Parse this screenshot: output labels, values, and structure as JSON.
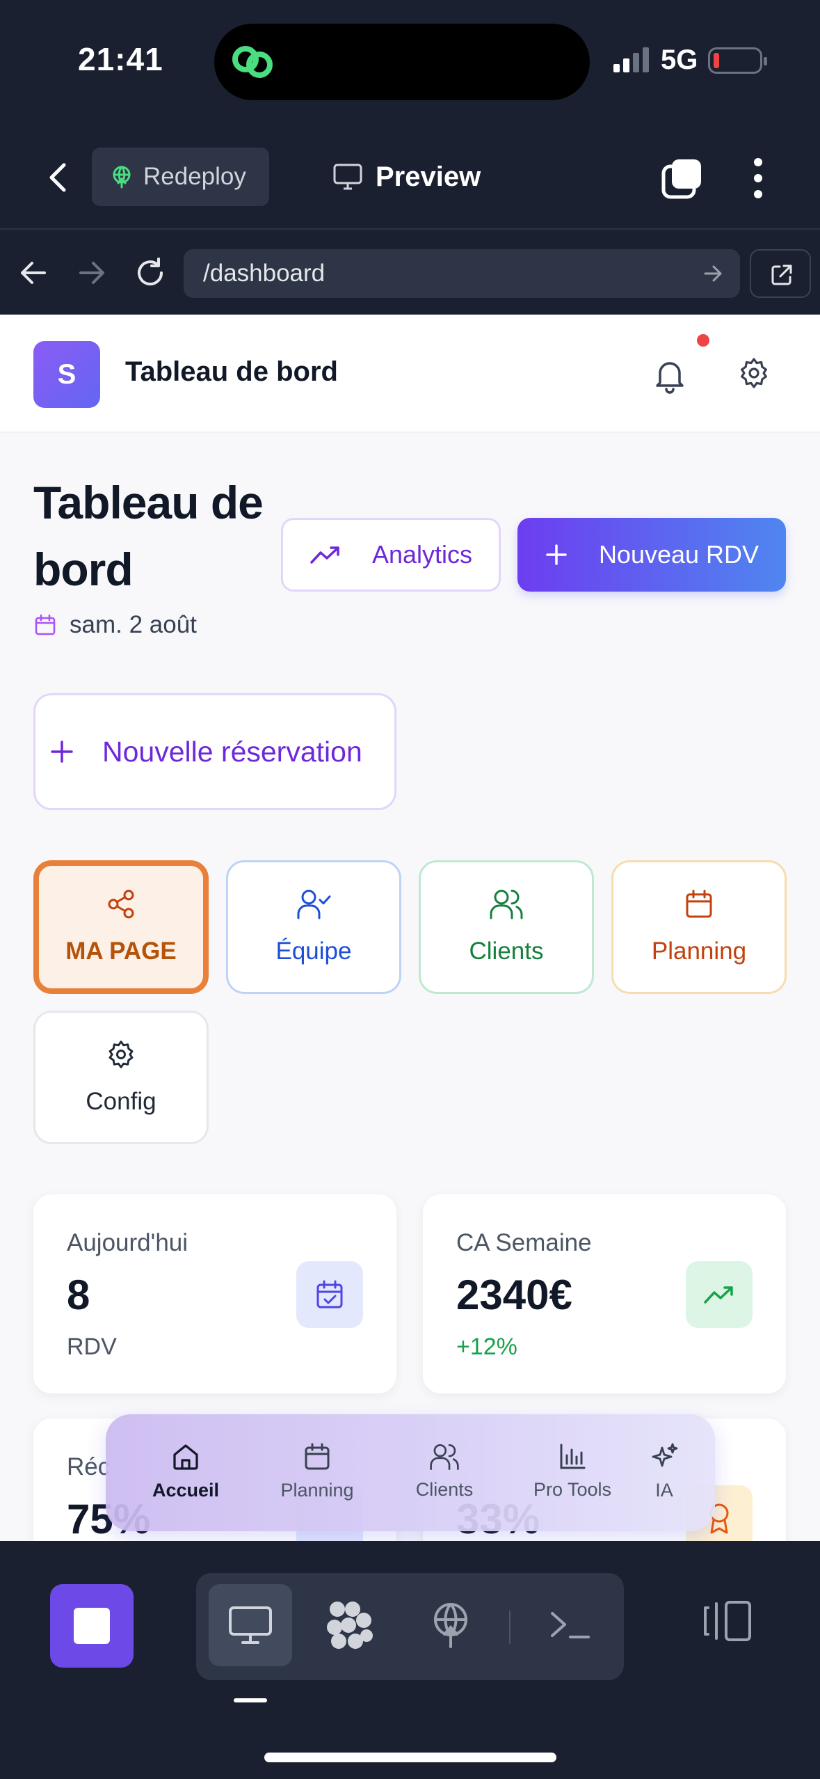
{
  "status": {
    "time": "21:41",
    "network": "5G"
  },
  "appbar": {
    "redeploy_label": "Redeploy",
    "preview_label": "Preview"
  },
  "browser": {
    "url": "/dashboard"
  },
  "page": {
    "header_title": "Tableau de bord",
    "logo_letter": "S",
    "title": "Tableau de bord",
    "date": "sam. 2 août",
    "analytics_label": "Analytics",
    "new_rdv_label": "Nouveau RDV",
    "new_reservation_label": "Nouvelle réservation",
    "tiles": {
      "ma_page": "MA PAGE",
      "equipe": "Équipe",
      "clients": "Clients",
      "planning": "Planning",
      "config": "Config"
    },
    "stats": {
      "today": {
        "label": "Aujourd'hui",
        "value": "8",
        "sub": "RDV"
      },
      "ca": {
        "label": "CA Semaine",
        "value": "2340€",
        "sub": "+12%"
      },
      "partial_left": {
        "label": "Réc",
        "value": "75%"
      },
      "partial_right": {
        "value": "33%"
      }
    }
  },
  "tabbar": {
    "items": [
      {
        "label": "Accueil",
        "icon": "home-icon",
        "active": true
      },
      {
        "label": "Planning",
        "icon": "calendar-icon",
        "active": false
      },
      {
        "label": "Clients",
        "icon": "users-icon",
        "active": false
      },
      {
        "label": "Pro Tools",
        "icon": "bar-chart-icon",
        "active": false
      },
      {
        "label": "IA",
        "icon": "sparkles-icon",
        "active": false
      }
    ]
  },
  "colors": {
    "accent_purple": "#6d28d9",
    "gradient_start": "#6d3df0",
    "gradient_end": "#4f86f0",
    "ma_page_orange": "#e8803a",
    "notification_dot": "#ef4444",
    "dark_chrome": "#1b2030"
  }
}
